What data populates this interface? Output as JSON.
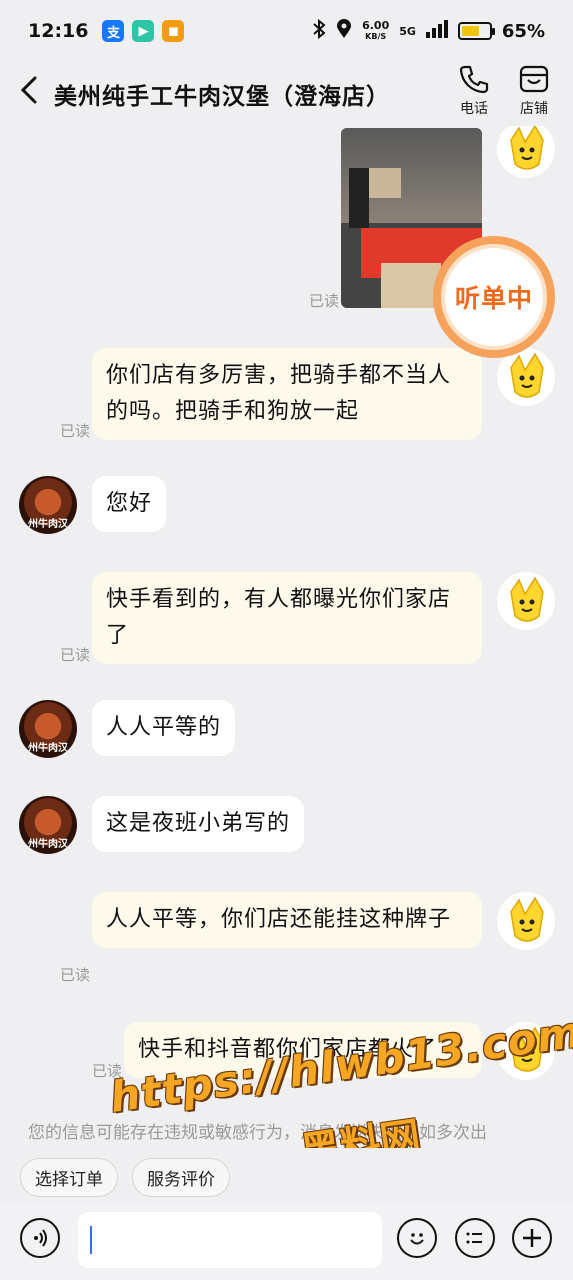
{
  "status_bar": {
    "time": "12:16",
    "speed_value": "6.00",
    "speed_unit": "KB/S",
    "network": "5G",
    "battery": "65%"
  },
  "header": {
    "title": "美州纯手工牛肉汉堡（澄海店）",
    "phone_label": "电话",
    "store_label": "店铺"
  },
  "overlay": {
    "stamp": "听单中"
  },
  "avatars": {
    "shop_text": "州牛肉汉"
  },
  "messages": [
    {
      "from": "me",
      "type": "image",
      "read": "已读"
    },
    {
      "from": "me",
      "text": "你们店有多厉害，把骑手都不当人的吗。把骑手和狗放一起",
      "read": "已读"
    },
    {
      "from": "them",
      "text": "您好"
    },
    {
      "from": "me",
      "text": "快手看到的，有人都曝光你们家店了",
      "read": "已读"
    },
    {
      "from": "them",
      "text": "人人平等的"
    },
    {
      "from": "them",
      "text": "这是夜班小弟写的"
    },
    {
      "from": "me",
      "text": "人人平等，你们店还能挂这种牌子",
      "read": "已读"
    },
    {
      "from": "me",
      "text": "快手和抖音都你们家店都火了",
      "read": "已读"
    }
  ],
  "notice": "您的信息可能存在违规或敏感行为，消息发送失败，如多次出",
  "watermark": {
    "url": "https://hlwb13.com",
    "name": "黑料网"
  },
  "quick_actions": [
    "选择订单",
    "服务评价"
  ],
  "input": {
    "value": ""
  }
}
